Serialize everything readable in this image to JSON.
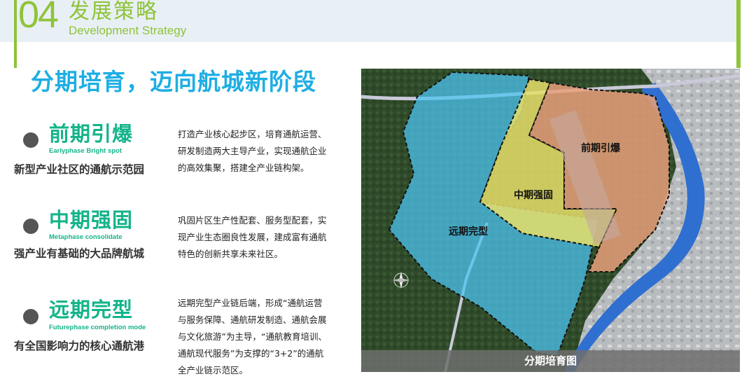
{
  "header": {
    "section_number": "04",
    "title_cn": "发展策略",
    "title_en": "Development Strategy"
  },
  "main_heading": "分期培育，迈向航城新阶段",
  "phases": [
    {
      "title": "前期引爆",
      "title_en": "Earlyphase Bright spot",
      "subtitle": "新型产业社区的通航示范园",
      "desc_lines": [
        "打造产业核心起步区，培育通航运营、",
        "研发制造两大主导产业，实现通航企业",
        "的高效集聚，搭建全产业链构架。"
      ]
    },
    {
      "title": "中期强固",
      "title_en": "Metaphase consolidate",
      "subtitle": "强产业有基础的大品牌航城",
      "desc_lines": [
        "巩固片区生产性配套、服务型配套，实",
        "现产业生态圈良性发展，建成富有通航",
        "特色的创新共享未来社区。"
      ]
    },
    {
      "title": "远期完型",
      "title_en": "Futurephase completion mode",
      "subtitle": "有全国影响力的核心通航港",
      "desc_lines": [
        "远期完型产业链后端，形成“通航运营",
        "与服务保障、通航研发制造、通航会展",
        "与文化旅游”为主导，“通航教育培训、",
        "通航现代服务”为支撑的“3+2”的通航",
        "全产业链示范区。"
      ]
    }
  ],
  "map": {
    "labels": {
      "early": "前期引爆",
      "mid": "中期强固",
      "far": "远期完型"
    },
    "caption": "分期培育图",
    "colors": {
      "early_zone": "#e8a07a",
      "mid_zone": "#e6df6a",
      "far_zone": "#4cc3ef",
      "river": "#2f6fd0",
      "forest": "#2f4a2a"
    }
  }
}
